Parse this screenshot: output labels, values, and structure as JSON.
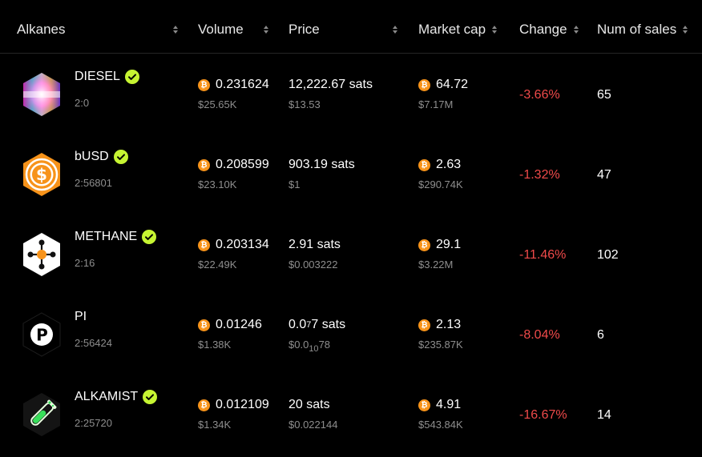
{
  "headers": {
    "alkanes": "Alkanes",
    "volume": "Volume",
    "price": "Price",
    "market_cap": "Market cap",
    "change": "Change",
    "num_sales": "Num of sales"
  },
  "colors": {
    "background": "#000000",
    "negative": "#f04a4a",
    "btc": "#f7931a",
    "verified": "#c6f432",
    "muted": "#8e8e8e"
  },
  "rows": [
    {
      "name": "DIESEL",
      "id": "2:0",
      "verified": true,
      "icon": "diesel-hex-logo",
      "volume_btc": "0.231624",
      "volume_usd": "$25.65K",
      "price_sats": "12,222.67 sats",
      "price_usd": "$13.53",
      "mcap_btc": "64.72",
      "mcap_usd": "$7.17M",
      "change": "-3.66%",
      "sales": "65"
    },
    {
      "name": "bUSD",
      "id": "2:56801",
      "verified": true,
      "icon": "dollar-coin-logo",
      "volume_btc": "0.208599",
      "volume_usd": "$23.10K",
      "price_sats": "903.19 sats",
      "price_usd": "$1",
      "mcap_btc": "2.63",
      "mcap_usd": "$290.74K",
      "change": "-1.32%",
      "sales": "47"
    },
    {
      "name": "METHANE",
      "id": "2:16",
      "verified": true,
      "icon": "molecule-logo",
      "volume_btc": "0.203134",
      "volume_usd": "$22.49K",
      "price_sats": "2.91 sats",
      "price_usd": "$0.003222",
      "mcap_btc": "29.1",
      "mcap_usd": "$3.22M",
      "change": "-11.46%",
      "sales": "102"
    },
    {
      "name": "PI",
      "id": "2:56424",
      "verified": false,
      "icon": "letter-p-logo",
      "volume_btc": "0.01246",
      "volume_usd": "$1.38K",
      "price_sats_prefix": "0.0",
      "price_sats_zeros": "7",
      "price_sats_suffix": "7 sats",
      "price_usd_prefix": "$0.0",
      "price_usd_zeros": "10",
      "price_usd_suffix": "78",
      "mcap_btc": "2.13",
      "mcap_usd": "$235.87K",
      "change": "-8.04%",
      "sales": "6"
    },
    {
      "name": "ALKAMIST",
      "id": "2:25720",
      "verified": true,
      "icon": "potion-tube-logo",
      "volume_btc": "0.012109",
      "volume_usd": "$1.34K",
      "price_sats": "20 sats",
      "price_usd": "$0.022144",
      "mcap_btc": "4.91",
      "mcap_usd": "$543.84K",
      "change": "-16.67%",
      "sales": "14"
    }
  ]
}
